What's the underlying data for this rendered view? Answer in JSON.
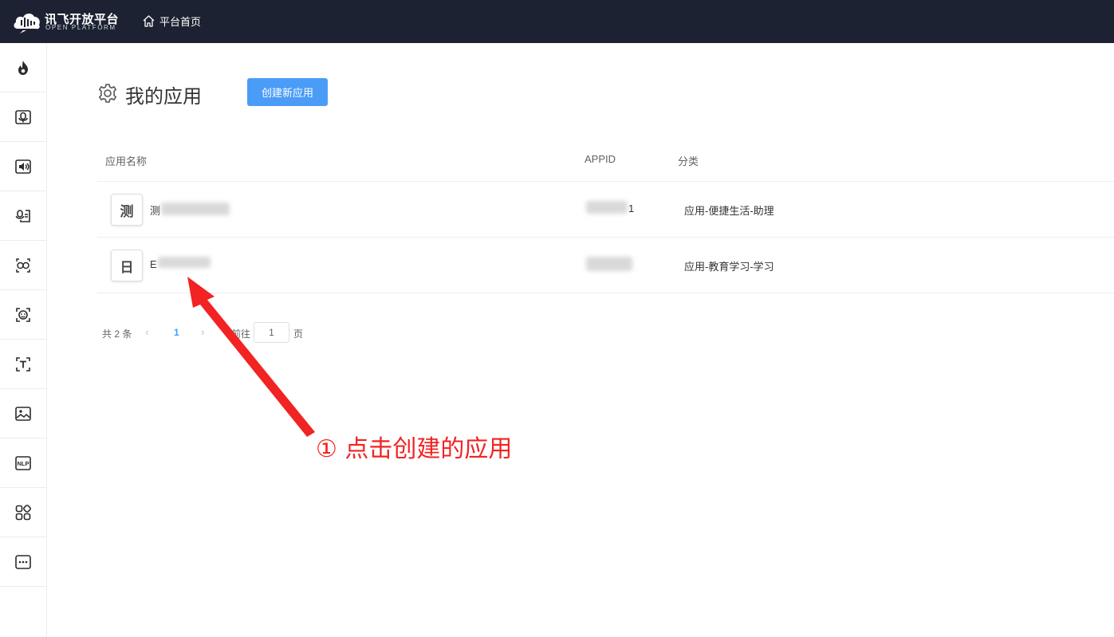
{
  "header": {
    "logo_cn": "讯飞开放平台",
    "logo_en": "OPEN PLATFORM",
    "home_label": "平台首页"
  },
  "sidebar": {
    "items": [
      {
        "icon": "flame-icon"
      },
      {
        "icon": "microphone-icon"
      },
      {
        "icon": "speaker-icon"
      },
      {
        "icon": "voice-card-icon"
      },
      {
        "icon": "face-compare-icon"
      },
      {
        "icon": "face-scan-icon"
      },
      {
        "icon": "text-ocr-icon"
      },
      {
        "icon": "image-icon"
      },
      {
        "icon": "nlp-icon"
      },
      {
        "icon": "apps-grid-icon"
      },
      {
        "icon": "more-icon"
      }
    ],
    "nlp_text": "NLP"
  },
  "main": {
    "title": "我的应用",
    "create_button": "创建新应用",
    "table": {
      "columns": [
        "应用名称",
        "APPID",
        "分类"
      ],
      "rows": [
        {
          "avatar": "测",
          "name_prefix": "测",
          "appid_visible": "1",
          "category": "应用-便捷生活-助理"
        },
        {
          "avatar": "日",
          "name_prefix": "E",
          "appid_visible": "",
          "category": "应用-教育学习-学习"
        }
      ]
    },
    "pagination": {
      "total": "共 2 条",
      "prev": "‹",
      "current": "1",
      "next": "›",
      "goto_label": "前往",
      "goto_value": "1",
      "page_label": "页"
    }
  },
  "annotation": {
    "text": "① 点击创建的应用",
    "color": "#f22323"
  },
  "colors": {
    "topbar": "#1d2232",
    "primary": "#4b9cf7",
    "link": "#409eff"
  }
}
